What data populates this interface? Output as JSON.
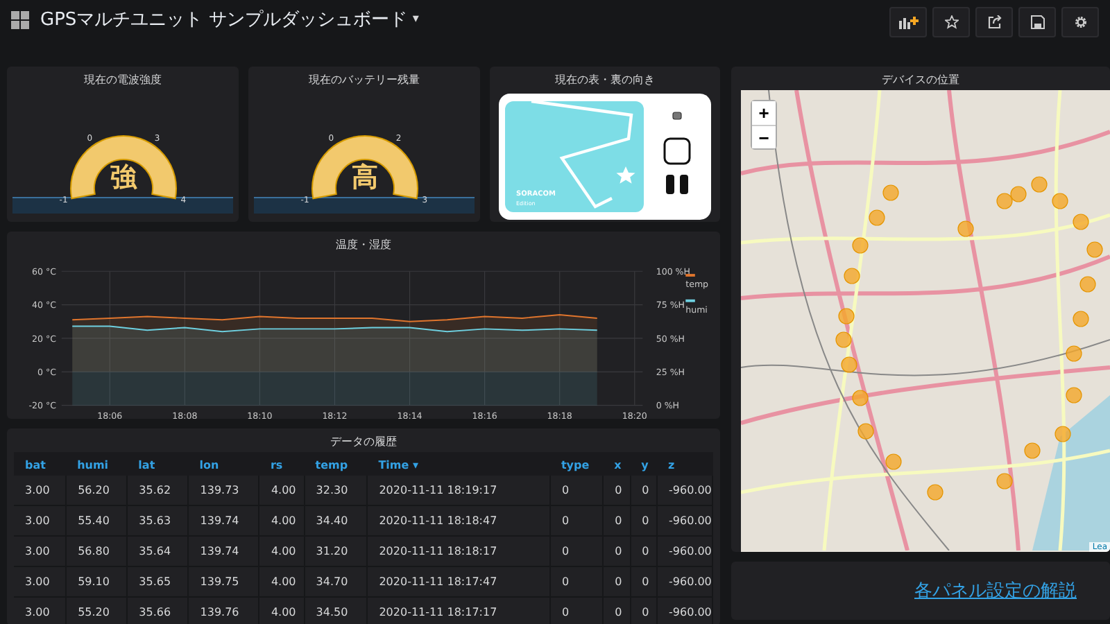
{
  "dashboard": {
    "title": "GPSマルチユニット サンプルダッシュボード",
    "caret": "▾"
  },
  "toolbar": [
    {
      "kind": "add-panel"
    },
    {
      "kind": "star"
    },
    {
      "kind": "share"
    },
    {
      "kind": "save"
    },
    {
      "kind": "settings"
    }
  ],
  "gauges": [
    {
      "title": "現在の電波強度",
      "value": "強",
      "level": 1,
      "ticks": [
        "-1",
        "0",
        "3",
        "4"
      ]
    },
    {
      "title": "現在のバッテリー残量",
      "value": "高",
      "level": 1,
      "ticks": [
        "-1",
        "0",
        "2",
        "3"
      ]
    }
  ],
  "orientation": {
    "title": "現在の表・裏の向き",
    "brand": "SORACOM",
    "edition": "Edition"
  },
  "chart": {
    "title": "温度・湿度",
    "chart_data": {
      "type": "area",
      "grid": true,
      "legend": true,
      "y2lim": [
        0,
        100
      ],
      "y2ticks": [
        {
          "value": 100,
          "label": "100 %H"
        },
        {
          "value": 75,
          "label": "75 %H"
        },
        {
          "value": 50,
          "label": "50 %H"
        },
        {
          "value": 25,
          "label": "25 %H"
        },
        {
          "value": 0,
          "label": "0 %H"
        }
      ],
      "categories": [
        null,
        "18:06",
        null,
        "18:08",
        null,
        "18:10",
        null,
        "18:12",
        null,
        "18:14",
        null,
        "18:16",
        null,
        "18:18",
        null,
        "18:20"
      ],
      "ylim": [
        -20,
        60
      ],
      "yticks": [
        {
          "value": 60,
          "label": "60 °C"
        },
        {
          "value": 40,
          "label": "40 °C"
        },
        {
          "value": 20,
          "label": "20 °C"
        },
        {
          "value": 0,
          "label": "0 °C"
        },
        {
          "value": -20,
          "label": "-20 °C"
        }
      ],
      "series": [
        {
          "name": "temp",
          "color": "#e0752d",
          "values": [
            31,
            32,
            33,
            32,
            31,
            33,
            32,
            32,
            32,
            30,
            31,
            33,
            32,
            34,
            32,
            null
          ]
        },
        {
          "name": "humi",
          "color": "#6ed0e0",
          "axis": "y2",
          "values": [
            59,
            59,
            56,
            58,
            55,
            57,
            57,
            57,
            58,
            58,
            55,
            57,
            56,
            57,
            56,
            null
          ]
        }
      ]
    }
  },
  "table": {
    "title": "データの履歴",
    "sort_caret": "▾",
    "columns": [
      {
        "label": "bat",
        "sorted": false
      },
      {
        "label": "humi",
        "sorted": false
      },
      {
        "label": "lat",
        "sorted": false
      },
      {
        "label": "lon",
        "sorted": false
      },
      {
        "label": "rs",
        "sorted": false
      },
      {
        "label": "temp",
        "sorted": false
      },
      {
        "label": "Time",
        "sorted": true
      },
      {
        "label": "type",
        "sorted": false
      },
      {
        "label": "x",
        "sorted": false
      },
      {
        "label": "y",
        "sorted": false
      },
      {
        "label": "z",
        "sorted": false
      }
    ],
    "rows": [
      [
        "3.00",
        "56.20",
        "35.62",
        "139.73",
        "4.00",
        "32.30",
        "2020-11-11 18:19:17",
        "0",
        "0",
        "0",
        "-960.00"
      ],
      [
        "3.00",
        "55.40",
        "35.63",
        "139.74",
        "4.00",
        "34.40",
        "2020-11-11 18:18:47",
        "0",
        "0",
        "0",
        "-960.00"
      ],
      [
        "3.00",
        "56.80",
        "35.64",
        "139.74",
        "4.00",
        "31.20",
        "2020-11-11 18:18:17",
        "0",
        "0",
        "0",
        "-960.00"
      ],
      [
        "3.00",
        "59.10",
        "35.65",
        "139.75",
        "4.00",
        "34.70",
        "2020-11-11 18:17:47",
        "0",
        "0",
        "0",
        "-960.00"
      ],
      [
        "3.00",
        "55.20",
        "35.66",
        "139.76",
        "4.00",
        "34.50",
        "2020-11-11 18:17:17",
        "0",
        "0",
        "0",
        "-960.00"
      ]
    ]
  },
  "map": {
    "title": "デバイスの位置",
    "zoom_in": "+",
    "zoom_out": "−",
    "attribution": "Lea"
  },
  "link": {
    "text": "各パネル設定の解説"
  }
}
